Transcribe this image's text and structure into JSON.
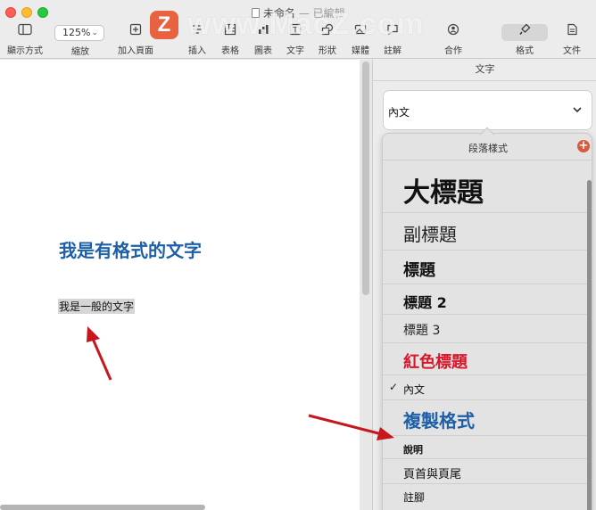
{
  "window": {
    "title": "未命名",
    "separator": "—",
    "status": "已編輯"
  },
  "watermark": {
    "logo_letter": "Z",
    "text": "www.MacZ.com"
  },
  "toolbar": {
    "zoom_value": "125%",
    "items": [
      {
        "label": "顯示方式",
        "icon": "sidebar-icon"
      },
      {
        "label": "縮放",
        "icon": "zoom-dropdown"
      },
      {
        "label": "加入頁面",
        "icon": "add-page-icon"
      },
      {
        "label": "插入",
        "icon": "insert-icon"
      },
      {
        "label": "表格",
        "icon": "table-icon"
      },
      {
        "label": "圖表",
        "icon": "chart-icon"
      },
      {
        "label": "文字",
        "icon": "text-icon"
      },
      {
        "label": "形狀",
        "icon": "shape-icon"
      },
      {
        "label": "媒體",
        "icon": "media-icon"
      },
      {
        "label": "註解",
        "icon": "comment-icon"
      },
      {
        "label": "合作",
        "icon": "collaborate-icon"
      },
      {
        "label": "格式",
        "icon": "format-brush-icon"
      },
      {
        "label": "文件",
        "icon": "document-icon"
      }
    ]
  },
  "document": {
    "heading_text": "我是有格式的文字",
    "body_text": "我是一般的文字"
  },
  "sidebar": {
    "tab": "文字",
    "style_select_value": "內文",
    "popup_title": "段落樣式",
    "styles": [
      {
        "label": "大標題",
        "checked": false
      },
      {
        "label": "副標題",
        "checked": false
      },
      {
        "label": "標題",
        "checked": false
      },
      {
        "label": "標題 2",
        "checked": false
      },
      {
        "label": "標題 3",
        "checked": false
      },
      {
        "label": "紅色標題",
        "checked": false
      },
      {
        "label": "內文",
        "checked": true
      },
      {
        "label": "複製格式",
        "checked": false
      },
      {
        "label": "說明",
        "checked": false
      },
      {
        "label": "頁首與頁尾",
        "checked": false
      },
      {
        "label": "註腳",
        "checked": false
      }
    ],
    "check_glyph": "✓"
  },
  "colors": {
    "heading_blue": "#1d5fa8",
    "red_heading": "#d9162a",
    "arrow_red": "#c8161d",
    "add_button": "#d95b3d"
  }
}
